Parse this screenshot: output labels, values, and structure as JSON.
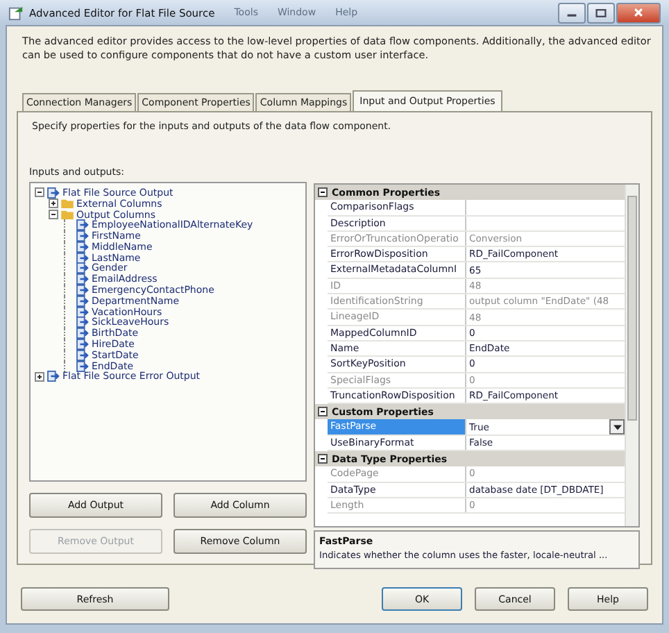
{
  "window": {
    "title": "Advanced Editor for Flat File Source",
    "background_menu": [
      "Tools",
      "Window",
      "Help"
    ]
  },
  "intro": "The advanced editor provides access to the low-level properties of data flow components. Additionally, the advanced editor can be used to configure components that do not have a custom user interface.",
  "tabs": [
    {
      "label": "Connection Managers",
      "selected": false
    },
    {
      "label": "Component Properties",
      "selected": false
    },
    {
      "label": "Column Mappings",
      "selected": false
    },
    {
      "label": "Input and Output Properties",
      "selected": true
    }
  ],
  "panel_hint": "Specify properties for the inputs and outputs of the data flow component.",
  "tree": {
    "label": "Inputs and outputs:",
    "items": [
      {
        "label": "Flat File Source Output",
        "kind": "output",
        "expanded": true,
        "children": [
          {
            "label": "External Columns",
            "kind": "folder",
            "expanded": false
          },
          {
            "label": "Output Columns",
            "kind": "folder",
            "expanded": true,
            "children": [
              {
                "label": "EmployeeNationalIDAlternateKey",
                "kind": "column"
              },
              {
                "label": "FirstName",
                "kind": "column"
              },
              {
                "label": "MiddleName",
                "kind": "column"
              },
              {
                "label": "LastName",
                "kind": "column"
              },
              {
                "label": "Gender",
                "kind": "column"
              },
              {
                "label": "EmailAddress",
                "kind": "column"
              },
              {
                "label": "EmergencyContactPhone",
                "kind": "column"
              },
              {
                "label": "DepartmentName",
                "kind": "column"
              },
              {
                "label": "VacationHours",
                "kind": "column"
              },
              {
                "label": "SickLeaveHours",
                "kind": "column"
              },
              {
                "label": "BirthDate",
                "kind": "column"
              },
              {
                "label": "HireDate",
                "kind": "column"
              },
              {
                "label": "StartDate",
                "kind": "column"
              },
              {
                "label": "EndDate",
                "kind": "column"
              }
            ]
          }
        ]
      },
      {
        "label": "Flat File Source Error Output",
        "kind": "output",
        "expanded": false
      }
    ]
  },
  "tree_buttons": [
    {
      "label": "Add Output",
      "disabled": false
    },
    {
      "label": "Add Column",
      "disabled": false
    },
    {
      "label": "Remove Output",
      "disabled": true
    },
    {
      "label": "Remove Column",
      "disabled": false
    }
  ],
  "property_grid": {
    "categories": [
      {
        "name": "Common Properties",
        "expanded": true,
        "rows": [
          {
            "name": "ComparisonFlags",
            "value": "",
            "disabled": false,
            "selected": false
          },
          {
            "name": "Description",
            "value": "",
            "disabled": false,
            "selected": false
          },
          {
            "name": "ErrorOrTruncationOperatio",
            "value": "Conversion",
            "disabled": true,
            "selected": false
          },
          {
            "name": "ErrorRowDisposition",
            "value": "RD_FailComponent",
            "disabled": false,
            "selected": false
          },
          {
            "name": "ExternalMetadataColumnI",
            "value": "65",
            "disabled": false,
            "selected": false
          },
          {
            "name": "ID",
            "value": "48",
            "disabled": true,
            "selected": false
          },
          {
            "name": "IdentificationString",
            "value": "output column \"EndDate\" (48",
            "disabled": true,
            "selected": false
          },
          {
            "name": "LineageID",
            "value": "48",
            "disabled": true,
            "selected": false
          },
          {
            "name": "MappedColumnID",
            "value": "0",
            "disabled": false,
            "selected": false
          },
          {
            "name": "Name",
            "value": "EndDate",
            "disabled": false,
            "selected": false
          },
          {
            "name": "SortKeyPosition",
            "value": "0",
            "disabled": false,
            "selected": false
          },
          {
            "name": "SpecialFlags",
            "value": "0",
            "disabled": true,
            "selected": false
          },
          {
            "name": "TruncationRowDisposition",
            "value": "RD_FailComponent",
            "disabled": false,
            "selected": false
          }
        ]
      },
      {
        "name": "Custom Properties",
        "expanded": true,
        "rows": [
          {
            "name": "FastParse",
            "value": "True",
            "disabled": false,
            "selected": true
          },
          {
            "name": "UseBinaryFormat",
            "value": "False",
            "disabled": false,
            "selected": false
          }
        ]
      },
      {
        "name": "Data Type Properties",
        "expanded": true,
        "rows": [
          {
            "name": "CodePage",
            "value": "0",
            "disabled": true,
            "selected": false
          },
          {
            "name": "DataType",
            "value": "database date [DT_DBDATE]",
            "disabled": false,
            "selected": false
          },
          {
            "name": "Length",
            "value": "0",
            "disabled": true,
            "selected": false
          }
        ]
      }
    ],
    "help_title": "FastParse",
    "help_text": "Indicates whether the column uses the faster, locale-neutral ..."
  },
  "footer_buttons": [
    {
      "label": "Refresh"
    },
    {
      "label": "OK",
      "default": true
    },
    {
      "label": "Cancel",
      "default": false
    },
    {
      "label": "Help",
      "default": false
    }
  ]
}
